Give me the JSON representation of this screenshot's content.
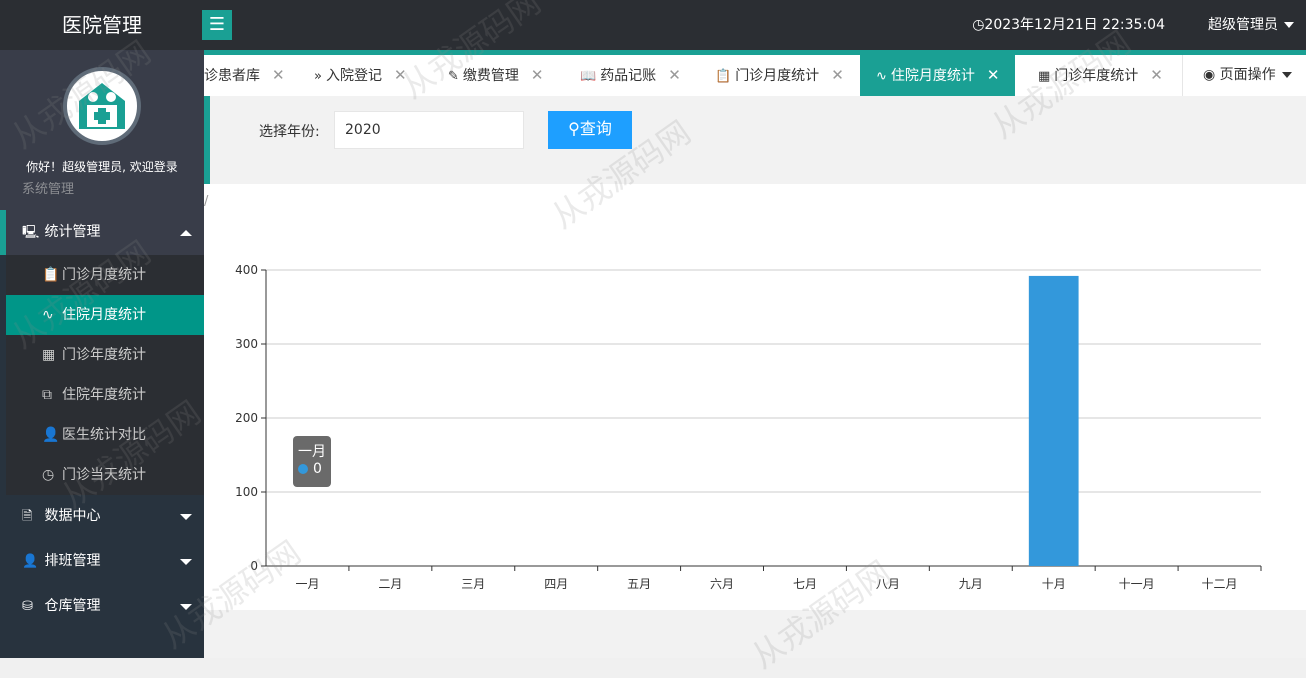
{
  "app": {
    "title": "医院管理",
    "menu_icon": "☰"
  },
  "header": {
    "datetime": "2023年12月21日 22:35:04",
    "user_label": "超级管理员"
  },
  "sidebar": {
    "welcome": "你好！超级管理员, 欢迎登录",
    "hidden_item": "系统管理",
    "groups": [
      {
        "label": "统计管理",
        "icon": "monitor-icon",
        "glyph": "🖳"
      },
      {
        "label": "数据中心",
        "icon": "document-icon",
        "glyph": "🗎"
      },
      {
        "label": "排班管理",
        "icon": "user-icon",
        "glyph": "👤"
      },
      {
        "label": "仓库管理",
        "icon": "boxes-icon",
        "glyph": "⛁"
      }
    ],
    "subitems": [
      {
        "label": "门诊月度统计",
        "glyph": "📋"
      },
      {
        "label": "住院月度统计",
        "glyph": "∿"
      },
      {
        "label": "门诊年度统计",
        "glyph": "▦"
      },
      {
        "label": "住院年度统计",
        "glyph": "⧉"
      },
      {
        "label": "医生统计对比",
        "glyph": "👤"
      },
      {
        "label": "门诊当天统计",
        "glyph": "◷"
      }
    ]
  },
  "tabs": [
    {
      "label": "诊患者库",
      "glyph": ""
    },
    {
      "label": "入院登记",
      "glyph": "»"
    },
    {
      "label": "缴费管理",
      "glyph": "✎"
    },
    {
      "label": "药品记账",
      "glyph": "📖"
    },
    {
      "label": "门诊月度统计",
      "glyph": "📋"
    },
    {
      "label": "住院月度统计",
      "glyph": "∿"
    },
    {
      "label": "门诊年度统计",
      "glyph": "▦"
    }
  ],
  "page_ops": {
    "label": "页面操作",
    "glyph": "◉"
  },
  "filter": {
    "label": "选择年份:",
    "year_value": "2020",
    "query_label": "查询",
    "query_glyph": "⚲"
  },
  "panel_mark": "/",
  "tooltip": {
    "category": "一月",
    "value": "0"
  },
  "watermark": "从戎源码网",
  "colors": {
    "accent": "#1aa094",
    "bar": "#3398db",
    "query_button": "#1e9fff",
    "sidebar_bg": "#28333e",
    "topbar_bg": "#2b2e33"
  },
  "chart_data": {
    "type": "bar",
    "categories": [
      "一月",
      "二月",
      "三月",
      "四月",
      "五月",
      "六月",
      "七月",
      "八月",
      "九月",
      "十月",
      "十一月",
      "十二月"
    ],
    "values": [
      0,
      0,
      0,
      0,
      0,
      0,
      0,
      0,
      0,
      392,
      0,
      0
    ],
    "ylim": [
      0,
      400
    ],
    "yticks": [
      0,
      100,
      200,
      300,
      400
    ],
    "title": "",
    "xlabel": "",
    "ylabel": "",
    "grid": true
  }
}
